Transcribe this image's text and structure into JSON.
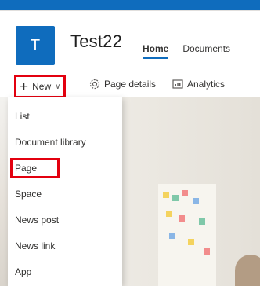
{
  "site": {
    "logo_letter": "T",
    "title": "Test22"
  },
  "nav": {
    "tabs": [
      "Home",
      "Documents"
    ]
  },
  "command_bar": {
    "new_label": "New",
    "page_details_label": "Page details",
    "analytics_label": "Analytics"
  },
  "menu": {
    "items": [
      "List",
      "Document library",
      "Page",
      "Space",
      "News post",
      "News link",
      "App"
    ]
  },
  "colors": {
    "brand": "#0f6cbd",
    "highlight": "#e3000f"
  }
}
